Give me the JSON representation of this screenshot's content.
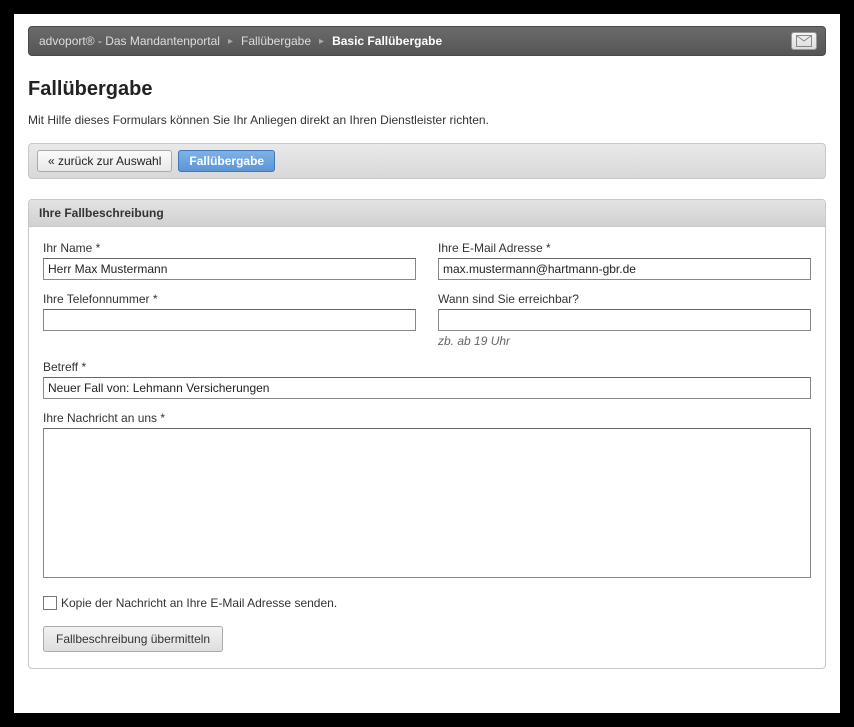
{
  "breadcrumb": {
    "item1": "advoport® - Das Mandantenportal",
    "item2": "Fallübergabe",
    "item3": "Basic Fallübergabe"
  },
  "page": {
    "title": "Fallübergabe",
    "description": "Mit Hilfe dieses Formulars können Sie Ihr Anliegen direkt an Ihren Dienstleister richten."
  },
  "tabs": {
    "back_label": "« zurück zur Auswahl",
    "active_label": "Fallübergabe"
  },
  "form": {
    "header": "Ihre Fallbeschreibung",
    "name": {
      "label": "Ihr Name *",
      "value": "Herr Max Mustermann"
    },
    "email": {
      "label": "Ihre E-Mail Adresse *",
      "value": "max.mustermann@hartmann-gbr.de"
    },
    "phone": {
      "label": "Ihre Telefonnummer *",
      "value": ""
    },
    "reach": {
      "label": "Wann sind Sie erreichbar?",
      "value": "",
      "hint": "zb. ab 19 Uhr"
    },
    "subject": {
      "label": "Betreff *",
      "value": "Neuer Fall von: Lehmann Versicherungen"
    },
    "message": {
      "label": "Ihre Nachricht an uns *",
      "value": ""
    },
    "copy_checkbox": {
      "label": "Kopie der Nachricht an Ihre E-Mail Adresse senden.",
      "checked": false
    },
    "submit_label": "Fallbeschreibung übermitteln"
  }
}
